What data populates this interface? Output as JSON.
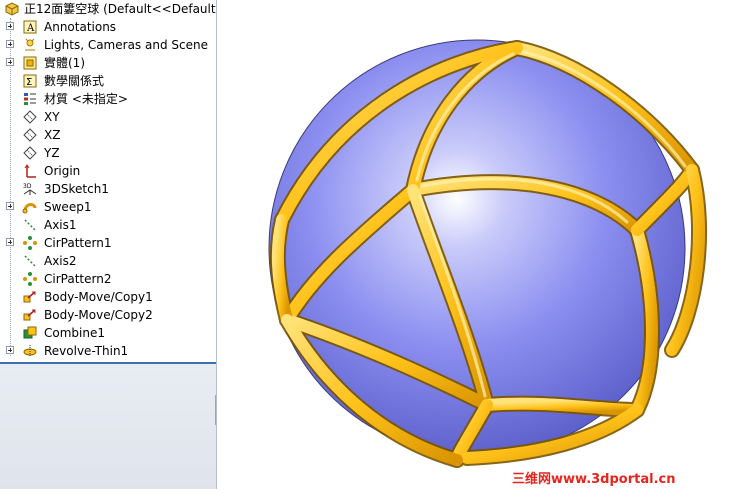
{
  "tree": {
    "root_label": "正12面簍空球 (Default<<Default>",
    "items": [
      {
        "label": "Annotations",
        "icon": "annotations-icon",
        "expandable": true
      },
      {
        "label": "Lights, Cameras and Scene",
        "icon": "lights-icon",
        "expandable": true
      },
      {
        "label": "實體(1)",
        "icon": "solid-bodies-icon",
        "expandable": true
      },
      {
        "label": "數學關係式",
        "icon": "equations-icon",
        "expandable": false
      },
      {
        "label": "材質 <未指定>",
        "icon": "material-icon",
        "expandable": false
      },
      {
        "label": "XY",
        "icon": "plane-icon",
        "expandable": false
      },
      {
        "label": "XZ",
        "icon": "plane-icon",
        "expandable": false
      },
      {
        "label": "YZ",
        "icon": "plane-icon",
        "expandable": false
      },
      {
        "label": "Origin",
        "icon": "origin-icon",
        "expandable": false
      },
      {
        "label": "3DSketch1",
        "icon": "sketch3d-icon",
        "expandable": false
      },
      {
        "label": "Sweep1",
        "icon": "sweep-icon",
        "expandable": true
      },
      {
        "label": "Axis1",
        "icon": "axis-icon",
        "expandable": false
      },
      {
        "label": "CirPattern1",
        "icon": "circular-pattern-icon",
        "expandable": true
      },
      {
        "label": "Axis2",
        "icon": "axis-icon",
        "expandable": false
      },
      {
        "label": "CirPattern2",
        "icon": "circular-pattern-icon",
        "expandable": false
      },
      {
        "label": "Body-Move/Copy1",
        "icon": "move-copy-icon",
        "expandable": false
      },
      {
        "label": "Body-Move/Copy2",
        "icon": "move-copy-icon",
        "expandable": false
      },
      {
        "label": "Combine1",
        "icon": "combine-icon",
        "expandable": false
      },
      {
        "label": "Revolve-Thin1",
        "icon": "revolve-icon",
        "expandable": true
      }
    ]
  },
  "viewport": {
    "model": "hollow-sphere-with-golden-ribs",
    "sphere_color": "#8c8ff0",
    "rib_color": "#ffc21a"
  },
  "watermark": "三维网www.3dportal.cn"
}
